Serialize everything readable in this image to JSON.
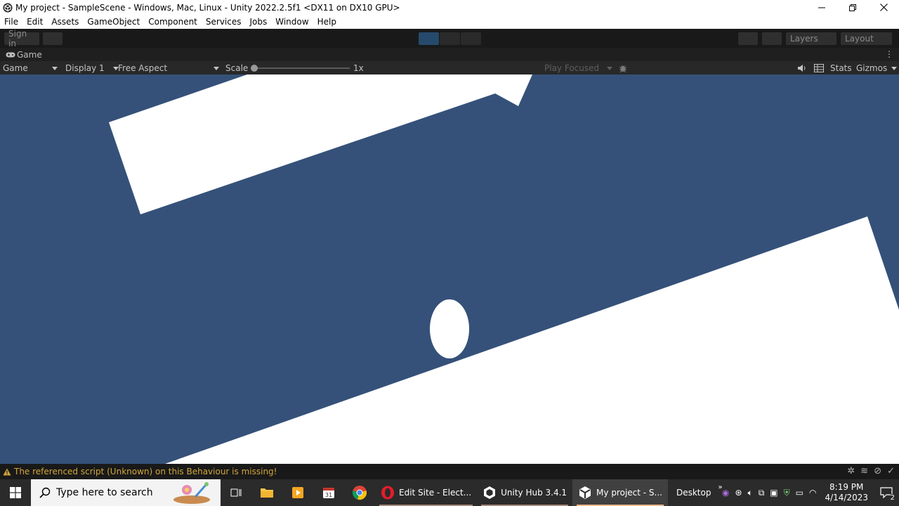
{
  "window": {
    "title": "My project - SampleScene - Windows, Mac, Linux - Unity 2022.2.5f1 <DX11 on DX10 GPU>",
    "app_icon": "unity-icon",
    "controls": [
      "minimize-icon",
      "restore-icon",
      "close-icon"
    ]
  },
  "menu": [
    "File",
    "Edit",
    "Assets",
    "GameObject",
    "Component",
    "Services",
    "Jobs",
    "Window",
    "Help"
  ],
  "toolbar": {
    "signin_label": "Sign in",
    "layers_label": "Layers",
    "layout_label": "Layout",
    "play_state": "playing"
  },
  "tab": {
    "label": "Game",
    "icon": "gamepad-icon"
  },
  "game_toolbar": {
    "view_label": "Game",
    "display_label": "Display 1",
    "aspect_label": "Free Aspect",
    "scale_label": "Scale",
    "scale_value": "1x",
    "play_mode_label": "Play Focused",
    "stats_label": "Stats",
    "gizmos_label": "Gizmos"
  },
  "colors": {
    "viewport_bg": "#355179",
    "shape_fill": "#ffffff",
    "warning": "#d2a63b"
  },
  "status": {
    "message": "The referenced script (Unknown) on this Behaviour is missing!",
    "icon": "warning-icon"
  },
  "taskbar": {
    "search_placeholder": "Type here to search",
    "apps": [
      {
        "label": "Edit Site - Elect...",
        "icon": "opera-icon"
      },
      {
        "label": "Unity Hub 3.4.1",
        "icon": "unity-hub-icon"
      },
      {
        "label": "My project - S...",
        "icon": "unity-icon"
      }
    ],
    "desktop_label": "Desktop",
    "time": "8:19 PM",
    "date": "4/14/2023",
    "notification_count": "2"
  }
}
